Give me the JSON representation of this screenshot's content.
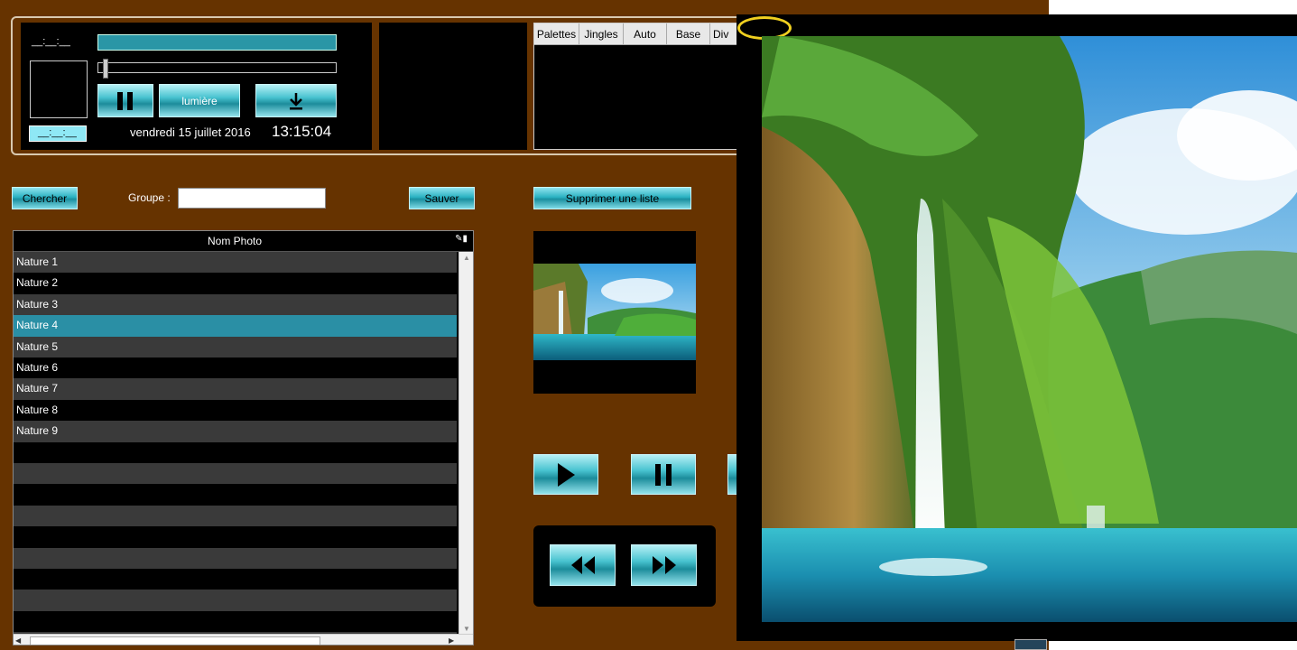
{
  "player": {
    "time_elapsed": "__:__:__",
    "time_remaining": "__:__:__",
    "pause_label": "II",
    "light_button": "lumière",
    "download_icon": "download-icon",
    "date": "vendredi 15 juillet 2016",
    "clock": "13:15:04",
    "progress": 0.02
  },
  "tabs": [
    "Palettes",
    "Jingles",
    "Auto",
    "Base",
    "Div"
  ],
  "toolbar": {
    "search_button": "Chercher",
    "group_label": "Groupe :",
    "group_value": "",
    "save_button": "Sauver",
    "delete_list_button": "Supprimer une liste"
  },
  "table": {
    "header": "Nom Photo",
    "rows": [
      "Nature 1",
      "Nature 2",
      "Nature 3",
      "Nature 4",
      "Nature 5",
      "Nature 6",
      "Nature 7",
      "Nature 8",
      "Nature 9",
      "",
      "",
      "",
      "",
      "",
      "",
      "",
      "",
      "",
      ""
    ],
    "selected_index": 3
  },
  "controls": {
    "play": "play-icon",
    "pause": "pause-icon",
    "rewind": "rewind-icon",
    "forward": "fast-forward-icon"
  },
  "colors": {
    "background": "#663300",
    "accent": "#2bb2c2",
    "selection": "#2a8fa5"
  }
}
